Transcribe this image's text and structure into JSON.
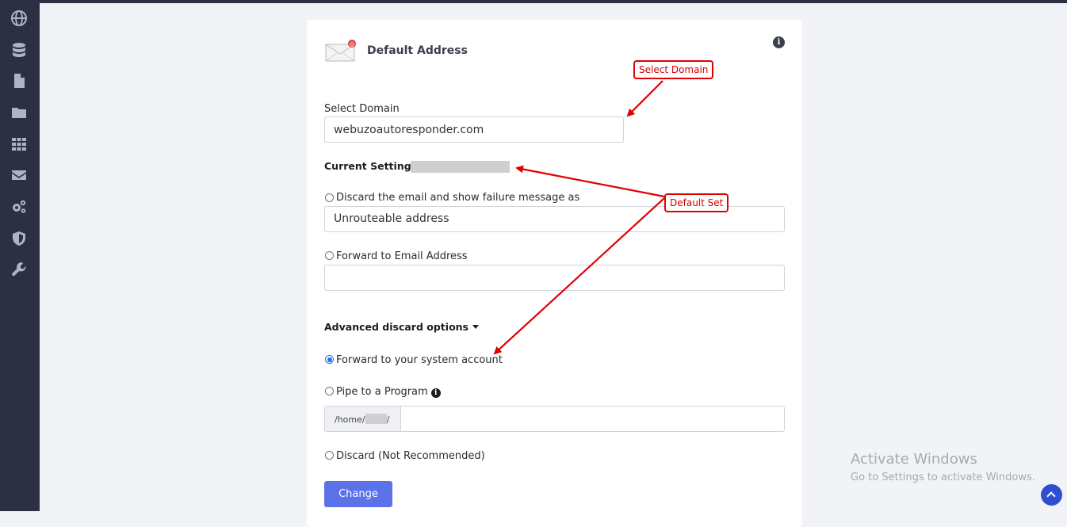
{
  "sidebar": {
    "icons": [
      "globe-icon",
      "database-icon",
      "file-icon",
      "folder-icon",
      "grid-icon",
      "envelope-icon",
      "gears-icon",
      "shield-icon",
      "wrench-icon"
    ]
  },
  "card": {
    "title": "Default Address",
    "info_symbol": "i",
    "select_domain_label": "Select Domain",
    "select_domain_value": "webuzoautoresponder.com",
    "current_setting_label": "Current Setting",
    "current_setting_separator": ":",
    "option_discard_failure_label": "Discard the email and show failure message as",
    "failure_message_value": "Unrouteable address",
    "option_forward_email_label": "Forward to Email Address",
    "forward_email_value": "",
    "advanced_title": "Advanced discard options",
    "option_system_account_label": "Forward to your system account",
    "option_pipe_label": "Pipe to a Program",
    "pipe_path_prefix_start": "/home/",
    "pipe_path_prefix_end": "/",
    "pipe_path_value": "",
    "option_discard_label": "Discard (Not Recommended)",
    "change_button": "Change",
    "selected_option": "Forward to your system account"
  },
  "annotations": {
    "select_domain_callout": "Select Domain",
    "default_set_callout": "Default Set",
    "color": "#e00000"
  },
  "watermark": {
    "title": "Activate Windows",
    "subtitle": "Go to Settings to activate Windows."
  },
  "colors": {
    "sidebar": "#2c3042",
    "accent": "#5b72e8",
    "background": "#f2f3f7"
  }
}
